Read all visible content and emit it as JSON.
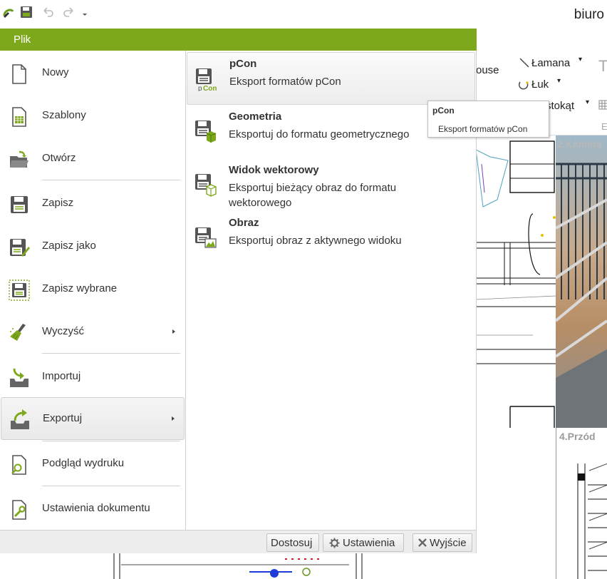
{
  "window": {
    "document_title": "biuro"
  },
  "quick_access": {
    "icons": [
      "app-logo-icon",
      "save-icon",
      "undo-icon",
      "redo-icon",
      "customize-dropdown-icon"
    ]
  },
  "ribbon": {
    "polyline_label": "Łamana",
    "arc_label": "Łuk",
    "house_fragment": "ouse",
    "rectangle_fragment": "stokąt",
    "t_fragment": "T",
    "e_fragment": "E"
  },
  "views": {
    "camera_label": "2.Kamera",
    "front_label": "4.Przód"
  },
  "file_menu": {
    "header": "Plik",
    "items": [
      {
        "key": "new",
        "label": "Nowy",
        "icon": "new-document-icon"
      },
      {
        "key": "templates",
        "label": "Szablony",
        "icon": "templates-icon"
      },
      {
        "key": "open",
        "label": "Otwórz",
        "icon": "open-folder-icon"
      },
      {
        "key": "save",
        "label": "Zapisz",
        "icon": "save-icon"
      },
      {
        "key": "save_as",
        "label": "Zapisz jako",
        "icon": "save-as-icon"
      },
      {
        "key": "save_selected",
        "label": "Zapisz wybrane",
        "icon": "save-selected-icon"
      },
      {
        "key": "clear",
        "label": "Wyczyść",
        "icon": "broom-icon",
        "submenu": true
      },
      {
        "key": "import",
        "label": "Importuj",
        "icon": "import-icon"
      },
      {
        "key": "export",
        "label": "Exportuj",
        "icon": "export-icon",
        "submenu": true,
        "selected": true
      },
      {
        "key": "print_preview",
        "label": "Podgląd wydruku",
        "icon": "print-preview-icon"
      },
      {
        "key": "doc_settings",
        "label": "Ustawienia dokumentu",
        "icon": "document-settings-icon"
      }
    ],
    "export_submenu": [
      {
        "key": "pcon",
        "title": "pCon",
        "description": "Eksport formatów pCon",
        "icon": "pcon-export-icon",
        "highlighted": true
      },
      {
        "key": "geometry",
        "title": "Geometria",
        "description": "Eksportuj do formatu geometrycznego",
        "icon": "geometry-export-icon"
      },
      {
        "key": "vector",
        "title": "Widok wektorowy",
        "description": "Eksportuj bieżący obraz do formatu wektorowego",
        "icon": "vector-export-icon"
      },
      {
        "key": "image",
        "title": "Obraz",
        "description": "Eksportuj obraz z aktywnego widoku",
        "icon": "image-export-icon"
      }
    ],
    "bottom_buttons": {
      "customize": "Dostosuj",
      "settings": "Ustawienia",
      "exit": "Wyjście"
    }
  },
  "tooltip": {
    "title": "pCon",
    "description": "Eksport formatów pCon"
  },
  "colors": {
    "accent_green": "#7ea81b",
    "icon_gray": "#555555",
    "icon_green": "#6a9a1a"
  }
}
